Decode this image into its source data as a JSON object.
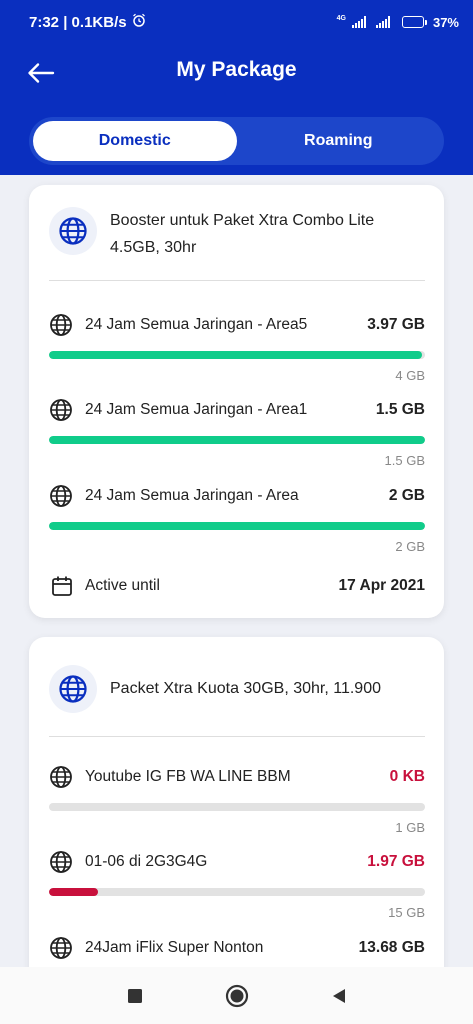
{
  "status_bar": {
    "time_speed": "7:32 | 0.1KB/s",
    "network": "4G",
    "battery": "37%",
    "battery_level": 0.37
  },
  "header": {
    "title": "My Package"
  },
  "tabs": [
    {
      "label": "Domestic",
      "active": true
    },
    {
      "label": "Roaming",
      "active": false
    }
  ],
  "colors": {
    "brand_blue": "#0a2fbf",
    "progress_green": "#10cc8a",
    "progress_red": "#c8103c"
  },
  "cards": [
    {
      "title_line1": "Booster untuk Paket Xtra Combo Lite",
      "title_line2": "4.5GB, 30hr",
      "icon": "globe-icon",
      "quotas": [
        {
          "name": "24 Jam Semua Jaringan - Area5",
          "value": "3.97 GB",
          "total": "4 GB",
          "used_fraction": 0.9925,
          "color": "green"
        },
        {
          "name": "24 Jam Semua Jaringan - Area1",
          "value": "1.5 GB",
          "total": "1.5 GB",
          "used_fraction": 1.0,
          "color": "green"
        },
        {
          "name": "24 Jam Semua Jaringan - Area",
          "value": "2 GB",
          "total": "2 GB",
          "used_fraction": 1.0,
          "color": "green"
        }
      ],
      "active_label": "Active until",
      "active_date": "17 Apr 2021"
    },
    {
      "title_line1": "Packet Xtra Kuota 30GB, 30hr, 11.900",
      "icon": "globe-icon",
      "quotas": [
        {
          "name": "Youtube IG FB WA LINE BBM",
          "value": "0 KB",
          "total": "1 GB",
          "used_fraction": 0.0,
          "color": "red"
        },
        {
          "name": "01-06 di 2G3G4G",
          "value": "1.97 GB",
          "total": "15 GB",
          "used_fraction": 0.131,
          "color": "red"
        },
        {
          "name": "24Jam iFlix Super Nonton",
          "value": "13.68 GB",
          "total": "",
          "used_fraction": null,
          "color": "default"
        }
      ]
    }
  ],
  "nav": [
    "recents-button",
    "home-button",
    "back-button"
  ]
}
